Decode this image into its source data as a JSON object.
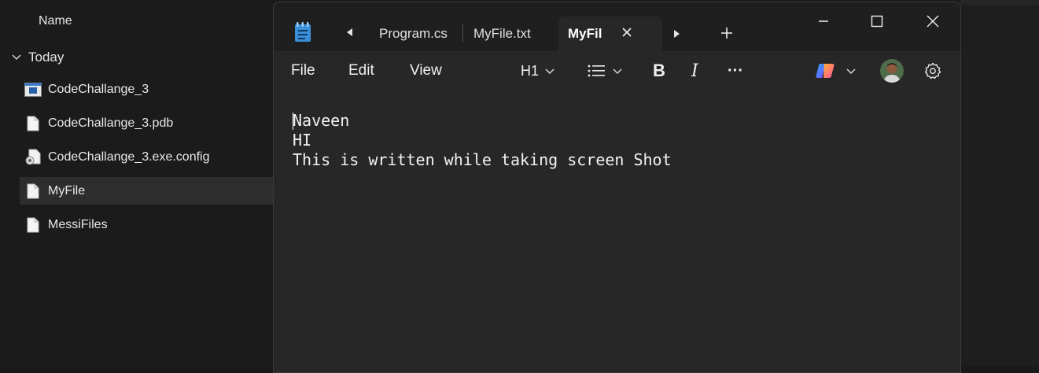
{
  "explorer": {
    "column_header": "Name",
    "group_label": "Today",
    "files": [
      {
        "name": "CodeChallange_3",
        "icon": "exe-app-icon",
        "selected": false
      },
      {
        "name": "CodeChallange_3.pdb",
        "icon": "document-icon",
        "selected": false
      },
      {
        "name": "CodeChallange_3.exe.config",
        "icon": "config-file-icon",
        "selected": false
      },
      {
        "name": "MyFile",
        "icon": "document-icon",
        "selected": true
      },
      {
        "name": "MessiFiles",
        "icon": "document-icon",
        "selected": false
      }
    ]
  },
  "notepad": {
    "tabs": [
      {
        "label": "Program.cs",
        "active": false
      },
      {
        "label": "MyFile.txt",
        "active": false
      },
      {
        "label": "MyFil",
        "active": true
      }
    ],
    "menu": {
      "file": "File",
      "edit": "Edit",
      "view": "View"
    },
    "toolbar": {
      "heading_label": "H1",
      "bold_glyph": "B",
      "italic_glyph": "I",
      "more_glyph": "···"
    },
    "editor": {
      "lines": [
        "Naveen",
        "HI",
        "This is written while taking screen Shot"
      ]
    },
    "colors": {
      "background": "#272727",
      "titlebar": "#1f1f1f",
      "app_icon_accent": "#3b8fd9"
    }
  }
}
